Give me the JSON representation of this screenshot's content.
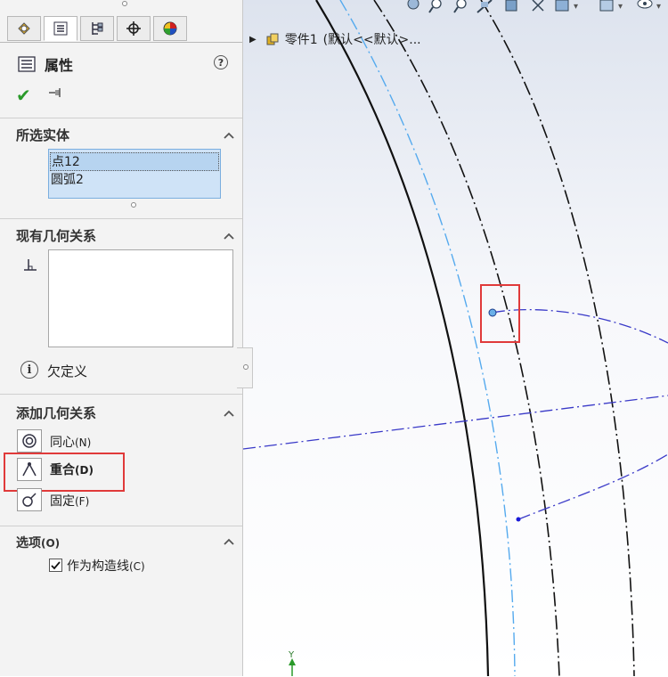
{
  "panel": {
    "tabs": [
      {
        "icon": "feature-manager-icon"
      },
      {
        "icon": "property-manager-icon",
        "active": true
      },
      {
        "icon": "configuration-manager-icon"
      },
      {
        "icon": "dimxpert-icon"
      },
      {
        "icon": "display-manager-icon"
      }
    ],
    "title": "属性",
    "help_icon": "?"
  },
  "selected_entities": {
    "title": "所选实体",
    "items": [
      "点12",
      "圆弧2"
    ]
  },
  "existing_relations": {
    "title": "现有几何关系",
    "status": "欠定义"
  },
  "add_relations": {
    "title": "添加几何关系",
    "items": [
      {
        "label": "同心",
        "shortcut": "(N)"
      },
      {
        "label": "重合",
        "shortcut": "(D)"
      },
      {
        "label": "固定",
        "shortcut": "(F)"
      }
    ]
  },
  "options": {
    "title": "选项",
    "shortcut": "(O)",
    "construction": {
      "label": "作为构造线",
      "shortcut": "(C)",
      "checked": true
    }
  },
  "tree": {
    "part": "零件1",
    "config": "(默认<<默认>..."
  },
  "axis_label": "Y",
  "colors": {
    "highlight": "#e03a3a",
    "sketch_blue": "#3a3ac8",
    "arc_light_blue": "#55aaee"
  }
}
